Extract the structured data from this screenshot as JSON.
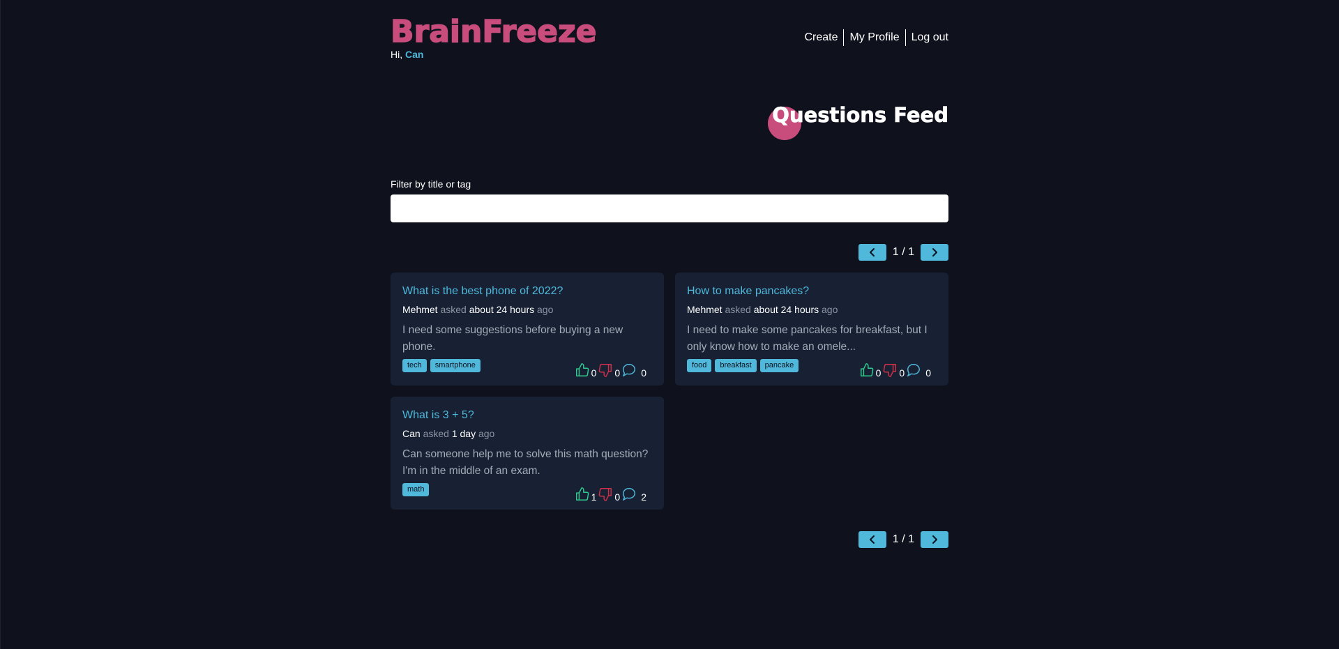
{
  "header": {
    "logo": "BrainFreeze",
    "greeting_prefix": "Hi,",
    "username": "Can",
    "nav": {
      "create": "Create",
      "profile": "My Profile",
      "logout": "Log out"
    }
  },
  "feed": {
    "title": "Questions Feed",
    "filter_label": "Filter by title or tag",
    "filter_value": "",
    "pagination": {
      "label": "1 / 1"
    }
  },
  "questions": [
    {
      "title": "What is the best phone of 2022?",
      "author": "Mehmet",
      "asked": "asked",
      "time": "about 24 hours",
      "ago": "ago",
      "description": "I need some suggestions before buying a new phone.",
      "tags": [
        "tech",
        "smartphone"
      ],
      "likes": "0",
      "dislikes": "0",
      "comments": "0"
    },
    {
      "title": "How to make pancakes?",
      "author": "Mehmet",
      "asked": "asked",
      "time": "about 24 hours",
      "ago": "ago",
      "description": "I need to make some pancakes for breakfast, but I only know how to make an omele...",
      "tags": [
        "food",
        "breakfast",
        "pancake"
      ],
      "likes": "0",
      "dislikes": "0",
      "comments": "0"
    },
    {
      "title": "What is 3 + 5?",
      "author": "Can",
      "asked": "asked",
      "time": "1 day",
      "ago": "ago",
      "description": "Can someone help me to solve this math question? I'm in the middle of an exam.",
      "tags": [
        "math"
      ],
      "likes": "1",
      "dislikes": "0",
      "comments": "2"
    }
  ],
  "icons": {
    "like": "thumbs-up-icon",
    "dislike": "thumbs-down-icon",
    "comment": "comment-bubble-icon",
    "prev": "chevron-left-icon",
    "next": "chevron-right-icon"
  },
  "colors": {
    "background": "#0f121d",
    "card": "#182133",
    "accent": "#4fb8db",
    "brand": "#c84d7c",
    "like": "#2ecc8f",
    "dislike": "#d0304a"
  }
}
